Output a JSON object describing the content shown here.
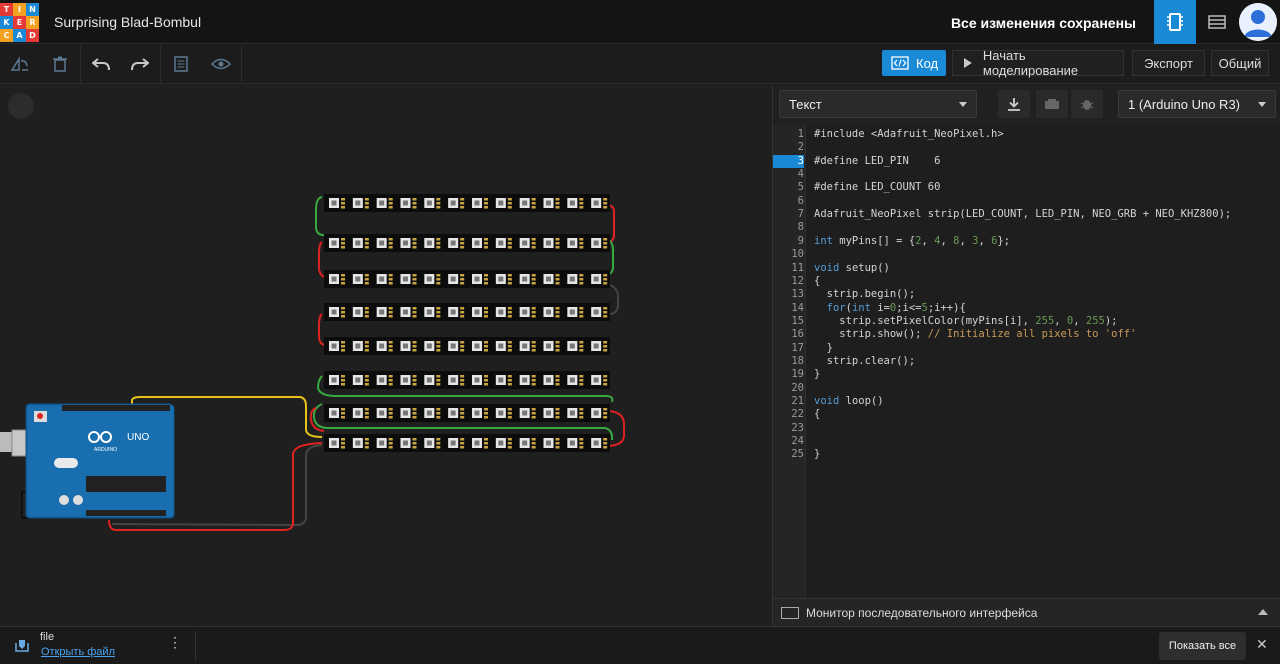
{
  "app": {
    "project_title": "Surprising Blad-Bombul",
    "save_status": "Все изменения сохранены",
    "logo_letters": [
      "T",
      "I",
      "N",
      "K",
      "E",
      "R",
      "C",
      "A",
      "D"
    ],
    "logo_colors": [
      "#e53935",
      "#f4a020",
      "#1a8ad6",
      "#1a8ad6",
      "#e53935",
      "#f4a020",
      "#f4a020",
      "#1a8ad6",
      "#e53935"
    ]
  },
  "toolbar": {
    "icons": [
      "rotate-icon",
      "delete-icon",
      "undo-icon",
      "redo-icon",
      "notes-icon",
      "visibility-icon"
    ],
    "code_label": "Код",
    "simulate_label": "Начать моделирование",
    "export_label": "Экспорт",
    "share_label": "Общий"
  },
  "code_panel": {
    "mode": "Текст",
    "device": "1 (Arduino Uno R3)",
    "active_line": 3,
    "lines": [
      "#include <Adafruit_NeoPixel.h>",
      "",
      "#define LED_PIN    6",
      "",
      "#define LED_COUNT 60",
      "",
      "Adafruit_NeoPixel strip(LED_COUNT, LED_PIN, NEO_GRB + NEO_KHZ800);",
      "",
      "int myPins[] = {2, 4, 8, 3, 6};",
      "",
      "void setup()",
      "{",
      "  strip.begin();",
      "  for(int i=0;i<=5;i++){",
      "    strip.setPixelColor(myPins[i], 255, 0, 255);",
      "    strip.show(); // Initialize all pixels to 'off'",
      "  }",
      "  strip.clear();",
      "}",
      "",
      "void loop()",
      "{",
      "",
      "",
      "}"
    ],
    "serial_monitor": "Монитор последовательного интерфейса"
  },
  "circuit": {
    "board_label": "UNO",
    "board_brand": "ARDUINO",
    "strip_rows": 8,
    "pixels_per_row": 12
  },
  "downloads": {
    "file_name": "file",
    "open_link": "Открыть файл",
    "show_all": "Показать все"
  }
}
